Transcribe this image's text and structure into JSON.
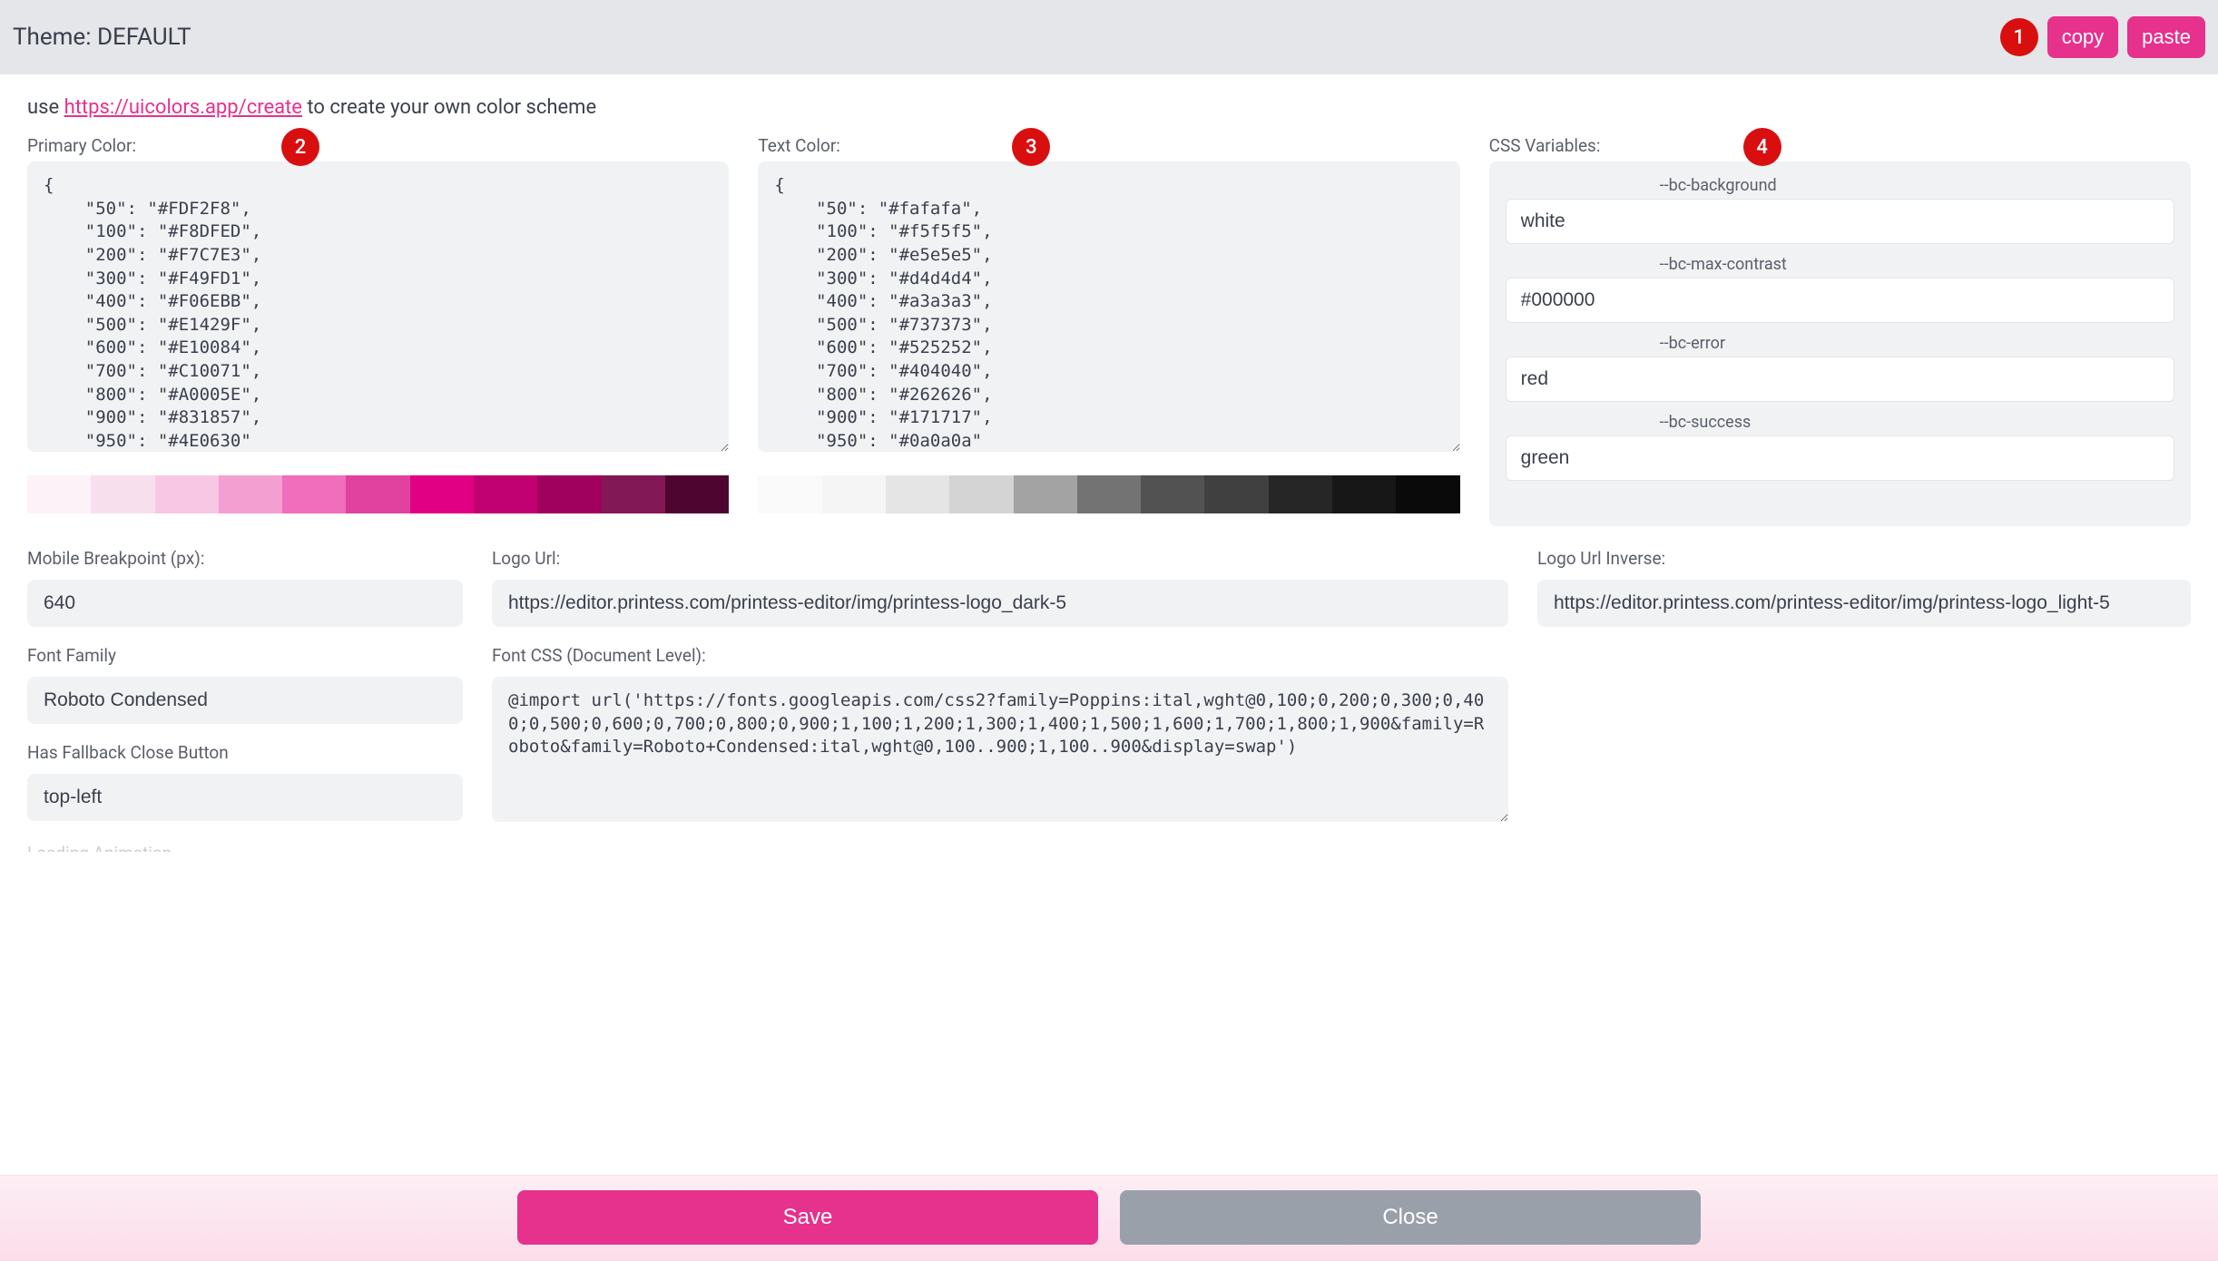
{
  "header": {
    "title": "Theme: DEFAULT",
    "copy_label": "copy",
    "paste_label": "paste",
    "badge1": "1"
  },
  "hint": {
    "prefix": "use ",
    "link_text": "https://uicolors.app/create",
    "suffix": " to create your own color scheme"
  },
  "primary": {
    "label": "Primary Color:",
    "badge": "2",
    "value": "{\n    \"50\": \"#FDF2F8\",\n    \"100\": \"#F8DFED\",\n    \"200\": \"#F7C7E3\",\n    \"300\": \"#F49FD1\",\n    \"400\": \"#F06EBB\",\n    \"500\": \"#E1429F\",\n    \"600\": \"#E10084\",\n    \"700\": \"#C10071\",\n    \"800\": \"#A0005E\",\n    \"900\": \"#831857\",\n    \"950\": \"#4E0630\"\n}",
    "swatches": [
      "#FDF2F8",
      "#F8DFED",
      "#F7C7E3",
      "#F49FD1",
      "#F06EBB",
      "#E1429F",
      "#E10084",
      "#C10071",
      "#A0005E",
      "#831857",
      "#4E0630"
    ]
  },
  "textcolor": {
    "label": "Text Color:",
    "badge": "3",
    "value": "{\n    \"50\": \"#fafafa\",\n    \"100\": \"#f5f5f5\",\n    \"200\": \"#e5e5e5\",\n    \"300\": \"#d4d4d4\",\n    \"400\": \"#a3a3a3\",\n    \"500\": \"#737373\",\n    \"600\": \"#525252\",\n    \"700\": \"#404040\",\n    \"800\": \"#262626\",\n    \"900\": \"#171717\",\n    \"950\": \"#0a0a0a\"\n}",
    "swatches": [
      "#fafafa",
      "#f5f5f5",
      "#e5e5e5",
      "#d4d4d4",
      "#a3a3a3",
      "#737373",
      "#525252",
      "#404040",
      "#262626",
      "#171717",
      "#0a0a0a"
    ]
  },
  "cssvars": {
    "label": "CSS Variables:",
    "badge": "4",
    "items": [
      {
        "name": "--bc-background",
        "value": "white"
      },
      {
        "name": "--bc-max-contrast",
        "value": "#000000"
      },
      {
        "name": "--bc-error",
        "value": "red"
      },
      {
        "name": "--bc-success",
        "value": "green"
      }
    ]
  },
  "mobile_bp": {
    "label": "Mobile Breakpoint (px):",
    "value": "640"
  },
  "logo_url": {
    "label": "Logo Url:",
    "value": "https://editor.printess.com/printess-editor/img/printess-logo_dark-5"
  },
  "logo_url_inv": {
    "label": "Logo Url Inverse:",
    "value": "https://editor.printess.com/printess-editor/img/printess-logo_light-5"
  },
  "font_family": {
    "label": "Font Family",
    "value": "Roboto Condensed"
  },
  "font_css": {
    "label": "Font CSS (Document Level):",
    "value": "@import url('https://fonts.googleapis.com/css2?family=Poppins:ital,wght@0,100;0,200;0,300;0,400;0,500;0,600;0,700;0,800;0,900;1,100;1,200;1,300;1,400;1,500;1,600;1,700;1,800;1,900&family=Roboto&family=Roboto+Condensed:ital,wght@0,100..900;1,100..900&display=swap')"
  },
  "fallback_close": {
    "label": "Has Fallback Close Button",
    "value": "top-left"
  },
  "cut_label": "Loading Animation",
  "footer": {
    "save": "Save",
    "close": "Close"
  }
}
